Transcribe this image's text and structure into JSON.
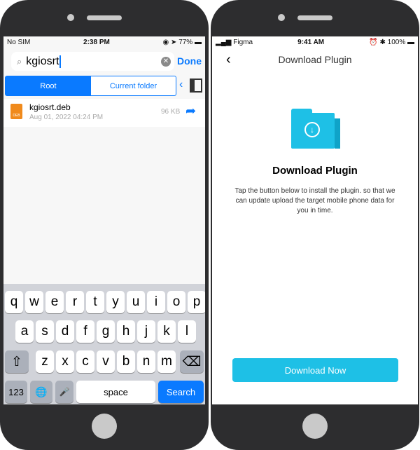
{
  "left": {
    "status": {
      "carrier": "No SIM",
      "time": "2:38 PM",
      "battery": "77%"
    },
    "search": {
      "value": "kgiosrt",
      "done": "Done"
    },
    "scope": {
      "root": "Root",
      "current": "Current folder"
    },
    "file": {
      "name": "kgiosrt.deb",
      "date": "Aug 01, 2022 04:24 PM",
      "size": "96 KB",
      "icon_label": "DEB"
    },
    "keyboard": {
      "row1": [
        "q",
        "w",
        "e",
        "r",
        "t",
        "y",
        "u",
        "i",
        "o",
        "p"
      ],
      "row2": [
        "a",
        "s",
        "d",
        "f",
        "g",
        "h",
        "j",
        "k",
        "l"
      ],
      "row3": [
        "z",
        "x",
        "c",
        "v",
        "b",
        "n",
        "m"
      ],
      "numbers": "123",
      "space": "space",
      "search": "Search"
    },
    "accent": "#0a7aff"
  },
  "right": {
    "status": {
      "carrier": "Figma",
      "time": "9:41 AM",
      "battery": "100%"
    },
    "nav_title": "Download Plugin",
    "heading": "Download Plugin",
    "description": "Tap the button below to install the plugin. so that we can update upload the target mobile phone data for you in time.",
    "button": "Download Now",
    "accent": "#1ec0e6"
  }
}
